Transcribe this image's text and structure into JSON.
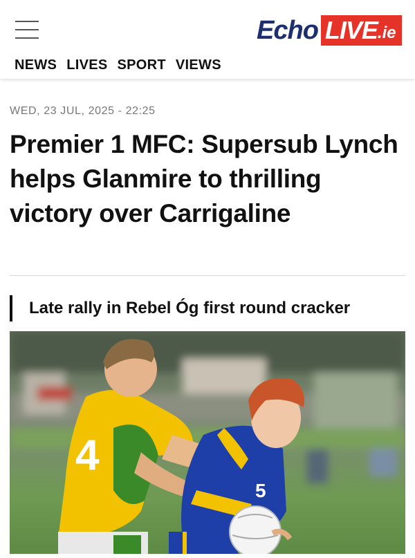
{
  "header": {
    "logo_echo": "Echo",
    "logo_live": "LIVE",
    "logo_ie": ".ie",
    "nav": [
      "NEWS",
      "LIVES",
      "SPORT",
      "VIEWS"
    ]
  },
  "article": {
    "dateline": "WED, 23 JUL, 2025 - 22:25",
    "headline": "Premier 1 MFC: Supersub Lynch helps Glanmire to thrilling victory over Carrigaline",
    "subheading": "Late rally in Rebel Óg first round cracker",
    "photo": {
      "left_player_number": "4",
      "right_player_number": "5"
    }
  },
  "colors": {
    "brand_blue": "#1d2f6f",
    "brand_red": "#e63329",
    "jersey_yellow": "#f2c200",
    "jersey_green": "#3a8a2a",
    "jersey_blue": "#1f3fa8",
    "pitch_green": "#6e9a52"
  },
  "icons": {
    "menu": "hamburger-menu-icon"
  }
}
